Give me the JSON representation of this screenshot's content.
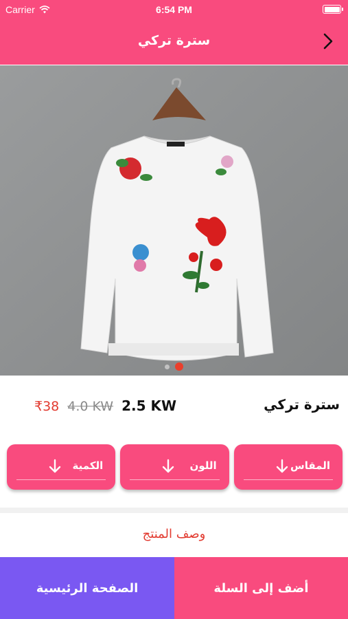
{
  "status_bar": {
    "carrier": "Carrier",
    "time": "6:54 PM"
  },
  "nav": {
    "title": "سترة تركي",
    "back_icon": "chevron-right-icon"
  },
  "product": {
    "image_icon": "sweatshirt-photo",
    "carousel": {
      "total": 2,
      "active": 2
    },
    "name": "سترة تركي",
    "price_rupee": "₹38",
    "price_old": "4.0 KW",
    "price_new": "2.5 KW"
  },
  "options": [
    {
      "label": "المقاس",
      "icon": "arrow-down-icon"
    },
    {
      "label": "اللون",
      "icon": "arrow-down-icon"
    },
    {
      "label": "الكمية",
      "icon": "arrow-down-icon"
    }
  ],
  "description": {
    "title": "وصف المنتج"
  },
  "bottom": {
    "home_label": "الصفحة الرئيسية",
    "cart_label": "أضف إلى السلة"
  },
  "colors": {
    "brand_pink": "#f94b7e",
    "brand_purple": "#7a58f2",
    "accent_red": "#e23b30"
  }
}
